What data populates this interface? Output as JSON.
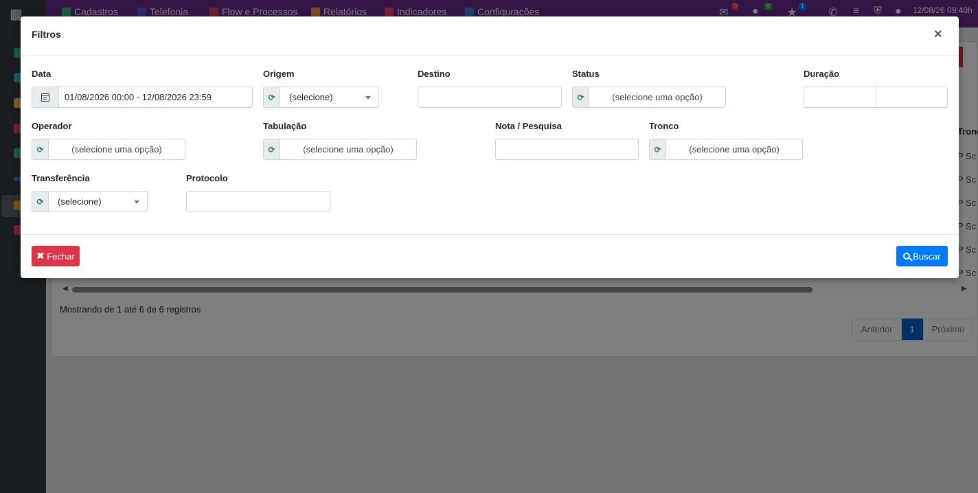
{
  "topbar": {
    "menu": [
      {
        "label": "Cadastros",
        "icon": "edit-icon",
        "color": "#2fbf71"
      },
      {
        "label": "Telefonia",
        "icon": "phone-icon",
        "color": "#5b5bd6"
      },
      {
        "label": "Flow e Processos",
        "icon": "flow-icon",
        "color": "#e0454f"
      },
      {
        "label": "Relatórios",
        "icon": "report-icon",
        "color": "#f0a030"
      },
      {
        "label": "Indicadores",
        "icon": "chart-icon",
        "color": "#e0455f"
      },
      {
        "label": "Configurações",
        "icon": "gear-icon",
        "color": "#3b7ddd"
      }
    ],
    "badges": {
      "mail": "0",
      "chat": "0",
      "star": "1"
    },
    "datetime": "12/08/26 09:40h"
  },
  "background": {
    "column_fragment": "Tronc",
    "row_fragments": [
      "P Sc",
      "P Sc",
      "P Sc",
      "P Sc",
      "P Sc",
      "P Sc"
    ],
    "records_info": "Mostrando de 1 até 6 de 6 registros",
    "pager": {
      "prev": "Anterior",
      "current": "1",
      "next": "Próximo"
    }
  },
  "modal": {
    "title": "Filtros",
    "close_symbol": "×",
    "fields": {
      "data": {
        "label": "Data",
        "value": "01/08/2026 00:00 - 12/08/2026 23:59"
      },
      "origem": {
        "label": "Origem",
        "value": "(selecione)"
      },
      "destino": {
        "label": "Destino",
        "value": ""
      },
      "status": {
        "label": "Status",
        "placeholder": "(selecione uma opção)"
      },
      "duracao": {
        "label": "Duração",
        "min": "",
        "max": ""
      },
      "operador": {
        "label": "Operador",
        "placeholder": "(selecione uma opção)"
      },
      "tabulacao": {
        "label": "Tabulação",
        "placeholder": "(selecione uma opção)"
      },
      "nota": {
        "label": "Nota / Pesquisa",
        "value": ""
      },
      "tronco": {
        "label": "Tronco",
        "placeholder": "(selecione uma opção)"
      },
      "transferencia": {
        "label": "Transferência",
        "value": "(selecione)"
      },
      "protocolo": {
        "label": "Protocolo",
        "value": ""
      }
    },
    "buttons": {
      "close": "Fechar",
      "search": "Buscar"
    }
  }
}
